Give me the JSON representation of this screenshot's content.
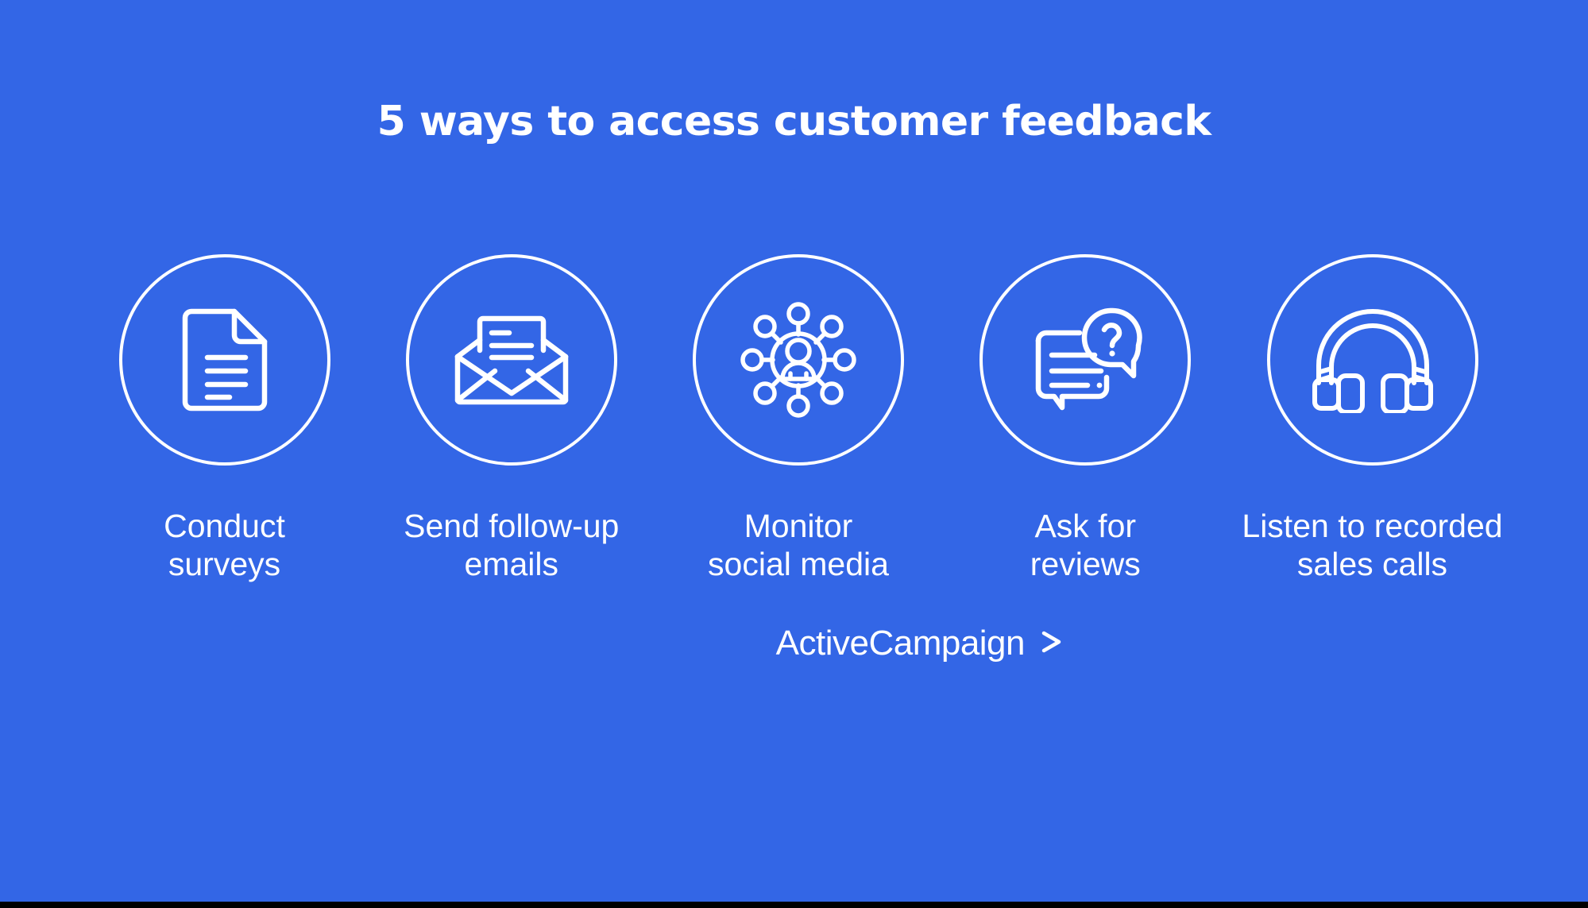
{
  "background_color": "#3366e6",
  "foreground_color": "#ffffff",
  "title": "5 ways to access customer feedback",
  "items": [
    {
      "icon": "document-icon",
      "label": "Conduct\nsurveys"
    },
    {
      "icon": "open-envelope-icon",
      "label": "Send follow-up\nemails"
    },
    {
      "icon": "social-network-person-icon",
      "label": "Monitor\nsocial media"
    },
    {
      "icon": "chat-bubbles-question-icon",
      "label": "Ask for\nreviews"
    },
    {
      "icon": "headphones-icon",
      "label": "Listen to recorded\nsales calls"
    }
  ],
  "logo": {
    "text": "ActiveCampaign",
    "icon": "chevron-right-icon"
  }
}
